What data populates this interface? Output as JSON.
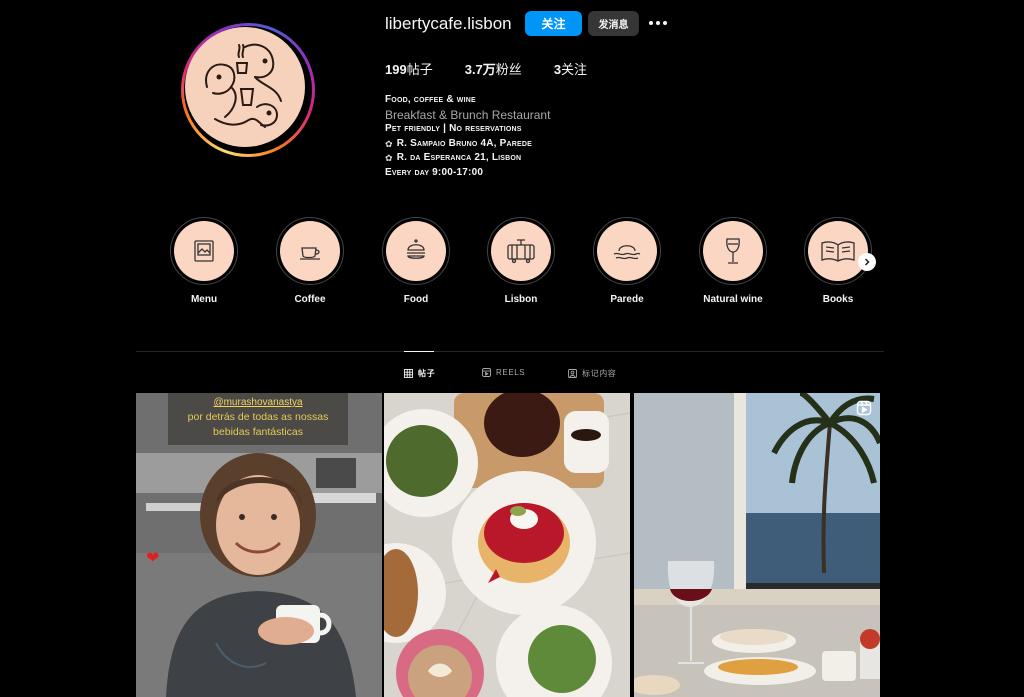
{
  "profile": {
    "username": "libertycafe.lisbon",
    "follow_label": "关注",
    "message_label": "发消息",
    "stats": [
      {
        "value": "199",
        "label": "帖子"
      },
      {
        "value": "3.7万",
        "label": "粉丝"
      },
      {
        "value": "3",
        "label": "关注"
      }
    ],
    "bio": {
      "line1": "Food, coffee & wine",
      "category": "Breakfast & Brunch Restaurant",
      "line3": "Pet friendly | No reservations",
      "line4": "R. Sampaio Bruno 4A, Parede",
      "line5": "R. da Esperanca 21, Lisbon",
      "line6": "Every day 9:00-17:00"
    }
  },
  "highlights": [
    {
      "label": "Menu",
      "icon": "photo-frame-icon"
    },
    {
      "label": "Coffee",
      "icon": "coffee-cup-icon"
    },
    {
      "label": "Food",
      "icon": "burger-icon"
    },
    {
      "label": "Lisbon",
      "icon": "tram-icon"
    },
    {
      "label": "Parede",
      "icon": "sunset-waves-icon"
    },
    {
      "label": "Natural wine",
      "icon": "wine-glass-icon"
    },
    {
      "label": "Books",
      "icon": "open-book-icon"
    }
  ],
  "tabs": [
    {
      "label": "帖子",
      "active": true
    },
    {
      "label": "REELS",
      "active": false
    },
    {
      "label": "标记内容",
      "active": false
    }
  ],
  "posts": {
    "first": {
      "handle": "@murashovanastya",
      "caption_line1": "por detrás de todas as nossas",
      "caption_line2": "bebidas fantásticas"
    }
  },
  "colors": {
    "accent": "#0095f6",
    "highlight_bg": "#fbd6c2",
    "background": "#000000"
  }
}
